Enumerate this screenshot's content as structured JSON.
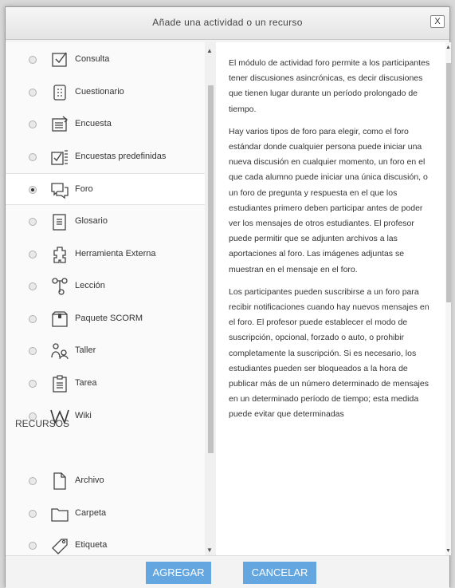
{
  "dialog": {
    "title": "Añade una actividad o un recurso",
    "close_label": "X"
  },
  "activities": [
    {
      "label": "Consulta",
      "icon": "choice-icon",
      "selected": false
    },
    {
      "label": "Cuestionario",
      "icon": "quiz-icon",
      "selected": false
    },
    {
      "label": "Encuesta",
      "icon": "survey-icon",
      "selected": false
    },
    {
      "label": "Encuestas predefinidas",
      "icon": "predefined-survey-icon",
      "selected": false
    },
    {
      "label": "Foro",
      "icon": "forum-icon",
      "selected": true
    },
    {
      "label": "Glosario",
      "icon": "glossary-icon",
      "selected": false
    },
    {
      "label": "Herramienta Externa",
      "icon": "external-tool-icon",
      "selected": false
    },
    {
      "label": "Lección",
      "icon": "lesson-icon",
      "selected": false
    },
    {
      "label": "Paquete SCORM",
      "icon": "scorm-package-icon",
      "selected": false
    },
    {
      "label": "Taller",
      "icon": "workshop-icon",
      "selected": false
    },
    {
      "label": "Tarea",
      "icon": "assignment-icon",
      "selected": false
    },
    {
      "label": "Wiki",
      "icon": "wiki-icon",
      "selected": false
    }
  ],
  "resources_heading": "RECURSOS",
  "resources": [
    {
      "label": "Archivo",
      "icon": "file-icon",
      "selected": false
    },
    {
      "label": "Carpeta",
      "icon": "folder-icon",
      "selected": false
    },
    {
      "label": "Etiqueta",
      "icon": "label-icon",
      "selected": false
    }
  ],
  "description": [
    "El módulo de actividad foro permite a los participantes tener discusiones asincrónicas, es decir discusiones que tienen lugar durante un período prolongado de tiempo.",
    "Hay varios tipos de foro para elegir, como el foro estándar donde cualquier persona puede iniciar una nueva discusión en cualquier momento, un foro en el que cada alumno puede iniciar una única discusión, o un foro de pregunta y respuesta en el que los estudiantes primero deben participar antes de poder ver los mensajes de otros estudiantes. El profesor puede permitir que se adjunten archivos a las aportaciones al foro. Las imágenes adjuntas se muestran en el mensaje en el foro.",
    "Los participantes pueden suscribirse a un foro para recibir notificaciones cuando hay nuevos mensajes en el foro. El profesor puede establecer el modo de suscripción, opcional, forzado o auto, o prohibir completamente la suscripción. Si es necesario, los estudiantes pueden ser bloqueados a la hora de publicar más de un número determinado de mensajes en un determinado período de tiempo; esta medida puede evitar que determinadas"
  ],
  "buttons": {
    "add": "AGREGAR",
    "cancel": "CANCELAR"
  },
  "colors": {
    "button": "#64a6e0",
    "selected_row": "#ffffff"
  }
}
